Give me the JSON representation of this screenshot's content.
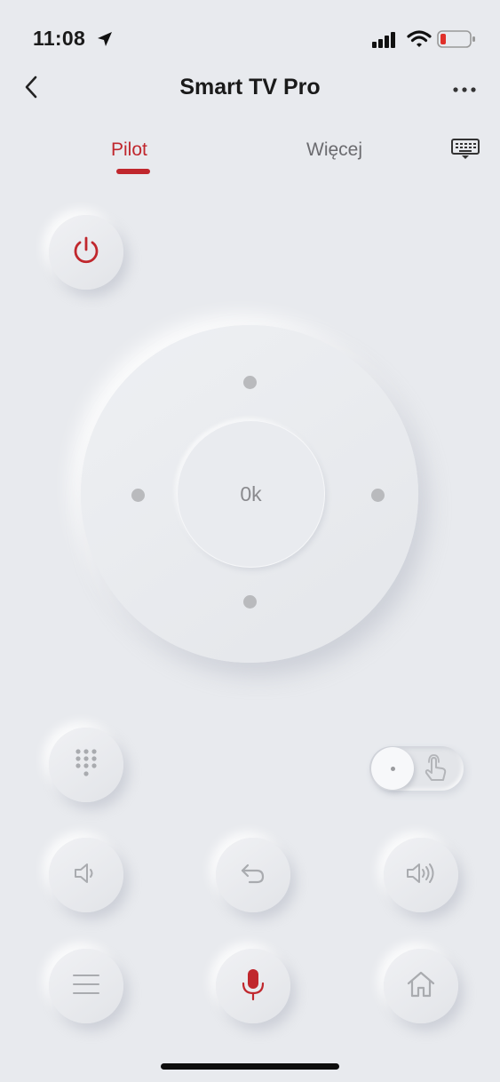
{
  "status_bar": {
    "time": "11:08"
  },
  "nav": {
    "title": "Smart TV Pro"
  },
  "tabs": [
    {
      "label": "Pilot",
      "active": true
    },
    {
      "label": "Więcej",
      "active": false
    }
  ],
  "remote": {
    "ok_label": "0k"
  },
  "colors": {
    "accent": "#c0272d",
    "background": "#e8eaee",
    "icon_gray": "#a9abaf"
  },
  "icons": {
    "location": "location-arrow-icon",
    "signal": "cellular-signal-icon",
    "wifi": "wifi-icon",
    "battery": "battery-low-icon",
    "back": "chevron-left-icon",
    "more": "more-horizontal-icon",
    "keyboard": "keyboard-icon",
    "power": "power-icon",
    "numpad": "numpad-icon",
    "touch": "touch-gesture-icon",
    "volume_down": "volume-down-icon",
    "back_command": "undo-return-icon",
    "volume_up": "volume-up-icon",
    "menu": "menu-lines-icon",
    "mic": "microphone-icon",
    "home": "home-icon"
  }
}
